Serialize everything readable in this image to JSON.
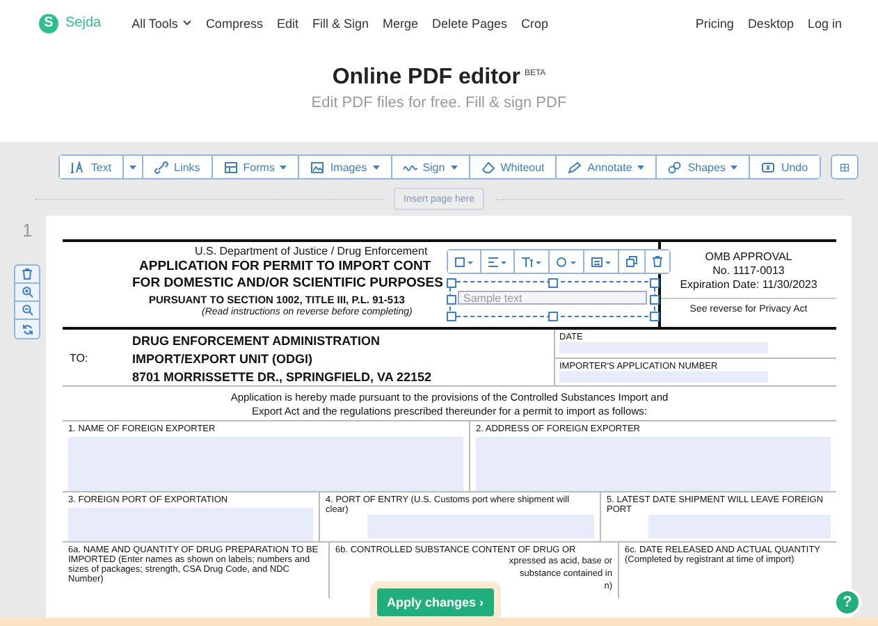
{
  "header": {
    "logo": {
      "mark": "S",
      "name": "Sejda"
    },
    "nav": [
      {
        "label": "All Tools",
        "caret": true
      },
      {
        "label": "Compress",
        "caret": false
      },
      {
        "label": "Edit",
        "caret": false
      },
      {
        "label": "Fill & Sign",
        "caret": false
      },
      {
        "label": "Merge",
        "caret": false
      },
      {
        "label": "Delete Pages",
        "caret": false
      },
      {
        "label": "Crop",
        "caret": false
      }
    ],
    "links": [
      "Pricing",
      "Desktop",
      "Log in"
    ]
  },
  "hero": {
    "title": "Online PDF editor",
    "badge": "BETA",
    "subtitle": "Edit PDF files for free. Fill & sign PDF"
  },
  "toolbar": [
    {
      "label": "Text",
      "caret": false,
      "split": true
    },
    {
      "label": "Links",
      "caret": false,
      "split": false
    },
    {
      "label": "Forms",
      "caret": true,
      "split": false
    },
    {
      "label": "Images",
      "caret": true,
      "split": false
    },
    {
      "label": "Sign",
      "caret": true,
      "split": false
    },
    {
      "label": "Whiteout",
      "caret": false,
      "split": false
    },
    {
      "label": "Annotate",
      "caret": true,
      "split": false
    },
    {
      "label": "Shapes",
      "caret": true,
      "split": false
    },
    {
      "label": "Undo",
      "caret": false,
      "split": false
    }
  ],
  "insert_page": "Insert page here",
  "page_number": "1",
  "text_box": {
    "placeholder": "Sample text"
  },
  "form": {
    "agency": "U.S. Department of Justice / Drug Enforcement",
    "title_lines": [
      "APPLICATION FOR PERMIT TO IMPORT CONT",
      "FOR DOMESTIC AND/OR SCIENTIFIC PURPOSES"
    ],
    "pursuant": "PURSUANT TO SECTION 1002, TITLE III, P.L. 91-513",
    "instructions": "(Read instructions on reverse before completing)",
    "omb": [
      "OMB APPROVAL",
      "No. 1117-0013",
      "Expiration Date: 11/30/2023"
    ],
    "privacy": "See reverse for Privacy Act",
    "to_label": "TO:",
    "address": [
      "DRUG ENFORCEMENT ADMINISTRATION",
      "IMPORT/EXPORT UNIT (ODGI)",
      "8701 MORRISSETTE DR., SPRINGFIELD, VA 22152"
    ],
    "date_label": "DATE",
    "app_number_label": "IMPORTER'S APPLICATION NUMBER",
    "intro": "Application is hereby made pursuant to the provisions of the Controlled Substances Import and Export Act and the regulations prescribed thereunder for a permit to import as follows:",
    "field_1": "1. NAME OF FOREIGN EXPORTER",
    "field_2": "2. ADDRESS OF FOREIGN EXPORTER",
    "field_3": "3. FOREIGN PORT OF EXPORTATION",
    "field_4": "4. PORT OF ENTRY (U.S. Customs port where shipment will clear)",
    "field_5": "5. LATEST DATE SHIPMENT WILL LEAVE FOREIGN PORT",
    "field_6a": "6a. NAME AND QUANTITY OF DRUG PREPARATION TO BE IMPORTED (Enter names as shown on labels; numbers and sizes of packages; strength, CSA Drug Code, and NDC Number)",
    "field_6b": "6b. CONTROLLED SUBSTANCE CONTENT OF DRUG OR",
    "field_6b_right": [
      "xpressed as acid, base or",
      "substance contained in",
      "n)"
    ],
    "field_6c": "6c. DATE RELEASED AND ACTUAL QUANTITY (Completed by registrant at time of import)"
  },
  "apply_button": "Apply changes ›",
  "help_button": "?"
}
